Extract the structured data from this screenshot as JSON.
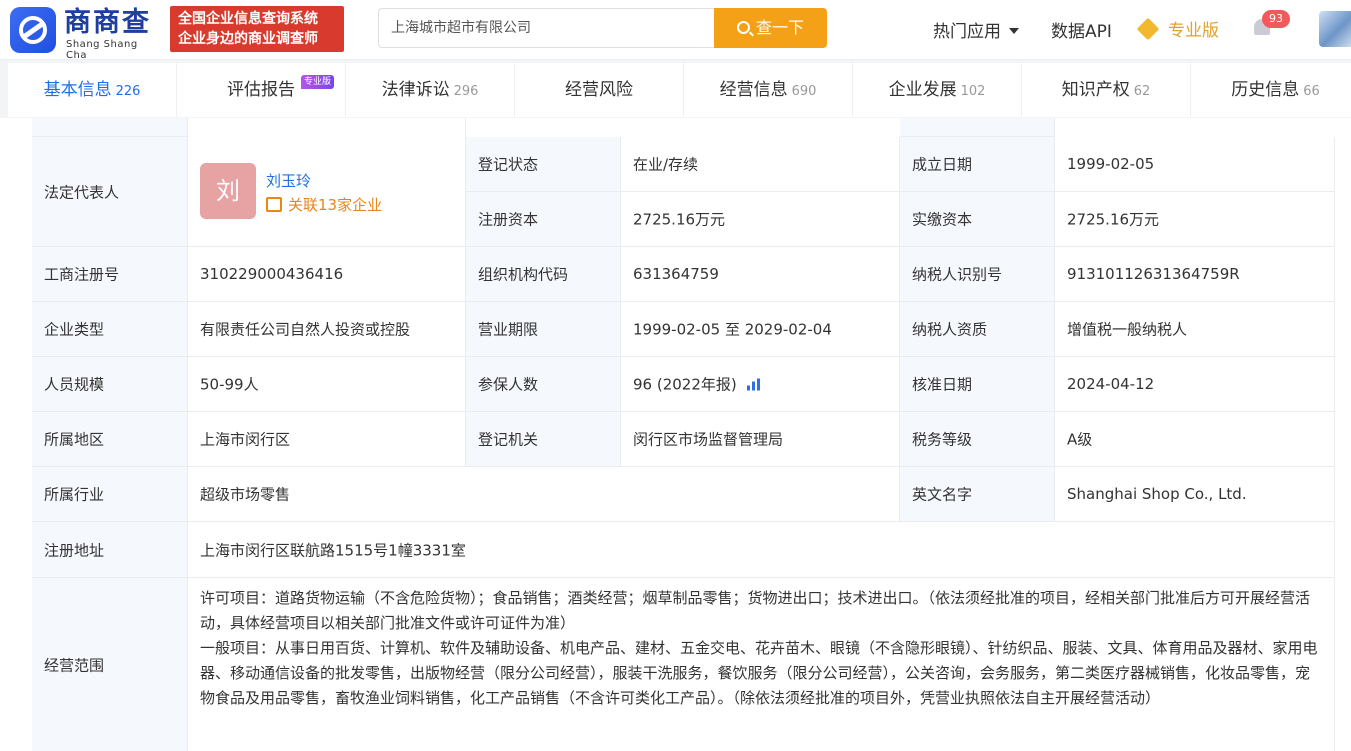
{
  "header": {
    "logo_cn": "商商查",
    "logo_en": "Shang Shang Cha",
    "slogan_line1": "全国企业信息查询系统",
    "slogan_line2": "企业身边的商业调查师",
    "search_value": "上海城市超市有限公司",
    "search_button": "查一下",
    "nav_hot": "热门应用",
    "nav_api": "数据API",
    "nav_pro": "专业版",
    "notification_count": "93"
  },
  "tabs": [
    {
      "label": "基本信息",
      "count": "226"
    },
    {
      "label": "评估报告",
      "count": "",
      "tag": "专业版"
    },
    {
      "label": "法律诉讼",
      "count": "296"
    },
    {
      "label": "经营风险",
      "count": ""
    },
    {
      "label": "经营信息",
      "count": "690"
    },
    {
      "label": "企业发展",
      "count": "102"
    },
    {
      "label": "知识产权",
      "count": "62"
    },
    {
      "label": "历史信息",
      "count": "66"
    }
  ],
  "legal_rep": {
    "label": "法定代表人",
    "avatar_char": "刘",
    "name": "刘玉玲",
    "assoc": "关联13家企业"
  },
  "fields": {
    "reg_status_label": "登记状态",
    "reg_status": "在业/存续",
    "est_date_label": "成立日期",
    "est_date": "1999-02-05",
    "reg_capital_label": "注册资本",
    "reg_capital": "2725.16万元",
    "paid_capital_label": "实缴资本",
    "paid_capital": "2725.16万元",
    "biz_reg_no_label": "工商注册号",
    "biz_reg_no": "310229000436416",
    "org_code_label": "组织机构代码",
    "org_code": "631364759",
    "tax_id_label": "纳税人识别号",
    "tax_id": "91310112631364759R",
    "company_type_label": "企业类型",
    "company_type": "有限责任公司自然人投资或控股",
    "term_label": "营业期限",
    "term": "1999-02-05 至 2029-02-04",
    "taxpayer_qual_label": "纳税人资质",
    "taxpayer_qual": "增值税一般纳税人",
    "staff_size_label": "人员规模",
    "staff_size": "50-99人",
    "insured_label": "参保人数",
    "insured": "96 (2022年报)",
    "approval_date_label": "核准日期",
    "approval_date": "2024-04-12",
    "region_label": "所属地区",
    "region": "上海市闵行区",
    "reg_authority_label": "登记机关",
    "reg_authority": "闵行区市场监督管理局",
    "tax_grade_label": "税务等级",
    "tax_grade": "A级",
    "industry_label": "所属行业",
    "industry": "超级市场零售",
    "english_name_label": "英文名字",
    "english_name": "Shanghai Shop Co., Ltd.",
    "address_label": "注册地址",
    "address": "上海市闵行区联航路1515号1幢3331室",
    "scope_label": "经营范围",
    "scope": "许可项目：道路货物运输（不含危险货物）；食品销售；酒类经营；烟草制品零售；货物进出口；技术进出口。（依法须经批准的项目，经相关部门批准后方可开展经营活动，具体经营项目以相关部门批准文件或许可证件为准）\n一般项目：从事日用百货、计算机、软件及辅助设备、机电产品、建材、五金交电、花卉苗木、眼镜（不含隐形眼镜）、针纺织品、服装、文具、体育用品及器材、家用电器、移动通信设备的批发零售，出版物经营（限分公司经营），服装干洗服务，餐饮服务（限分公司经营），公关咨询，会务服务，第二类医疗器械销售，化妆品零售，宠物食品及用品零售，畜牧渔业饲料销售，化工产品销售（不含许可类化工产品）。（除依法须经批准的项目外，凭营业执照依法自主开展经营活动）"
  }
}
